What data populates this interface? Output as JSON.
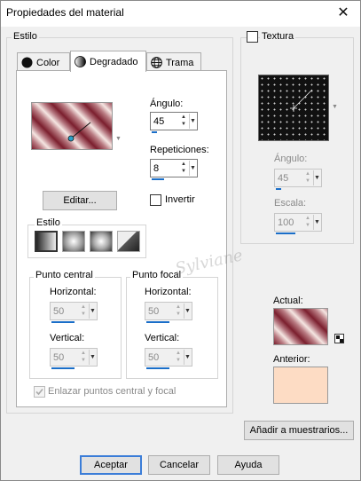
{
  "window": {
    "title": "Propiedades del material",
    "close_label": "✕"
  },
  "estilo_group": {
    "label": "Estilo"
  },
  "tabs": [
    {
      "label": "Color",
      "icon": "color-circle-icon"
    },
    {
      "label": "Degradado",
      "icon": "gradient-circle-icon"
    },
    {
      "label": "Trama",
      "icon": "pattern-globe-icon"
    }
  ],
  "gradient": {
    "angle_label": "Ángulo:",
    "angle_value": "45",
    "repeat_label": "Repeticiones:",
    "repeat_value": "8",
    "edit_label": "Editar...",
    "invert_label": "Invertir",
    "invert_checked": false,
    "style_label": "Estilo",
    "colors": {
      "dark": "#7b1f2e",
      "mid": "#b97b82",
      "light": "#f5e6e2"
    }
  },
  "center_point": {
    "label": "Punto central",
    "horizontal_label": "Horizontal:",
    "horizontal_value": "50",
    "vertical_label": "Vertical:",
    "vertical_value": "50"
  },
  "focal_point": {
    "label": "Punto focal",
    "horizontal_label": "Horizontal:",
    "horizontal_value": "50",
    "vertical_label": "Vertical:",
    "vertical_value": "50"
  },
  "link_points_label": "Enlazar puntos central y focal",
  "texture": {
    "label": "Textura",
    "checked": false,
    "angle_label": "Ángulo:",
    "angle_value": "45",
    "scale_label": "Escala:",
    "scale_value": "100"
  },
  "current_label": "Actual:",
  "previous_label": "Anterior:",
  "previous_color": "#fddcc4",
  "add_swatches_label": "Añadir a muestrarios...",
  "buttons": {
    "accept": "Aceptar",
    "cancel": "Cancelar",
    "help": "Ayuda"
  },
  "watermark": "Sylviane"
}
